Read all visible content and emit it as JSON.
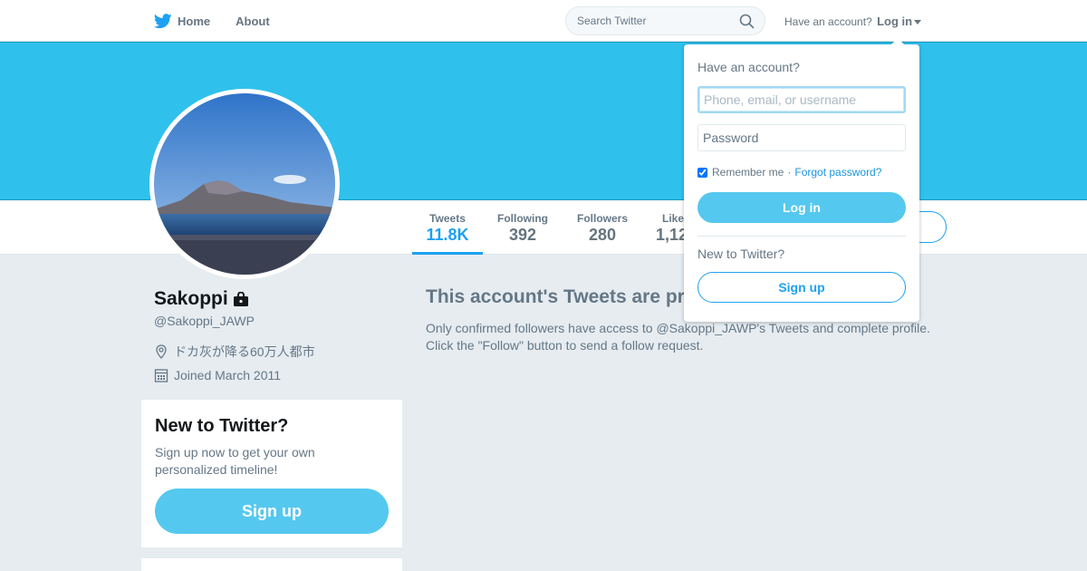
{
  "topbar": {
    "home_label": "Home",
    "about_label": "About",
    "search_placeholder": "Search Twitter",
    "have_account_text": "Have an account?",
    "login_label": "Log in"
  },
  "profile": {
    "name": "Sakoppi",
    "handle": "@Sakoppi_JAWP",
    "location": "ドカ灰が降る60万人都市",
    "joined": "Joined March 2011"
  },
  "stats": [
    {
      "label": "Tweets",
      "value": "11.8K",
      "active": true
    },
    {
      "label": "Following",
      "value": "392",
      "active": false
    },
    {
      "label": "Followers",
      "value": "280",
      "active": false
    },
    {
      "label": "Likes",
      "value": "1,12",
      "active": false
    }
  ],
  "signup_card": {
    "title": "New to Twitter?",
    "text": "Sign up now to get your own personalized timeline!",
    "button": "Sign up"
  },
  "protected": {
    "title": "This account's Tweets are protected.",
    "line1": "Only confirmed followers have access to @Sakoppi_JAWP's Tweets and complete profile.",
    "line2": "Click the \"Follow\" button to send a follow request."
  },
  "login_dropdown": {
    "heading": "Have an account?",
    "username_placeholder": "Phone, email, or username",
    "password_placeholder": "Password",
    "remember_label": "Remember me",
    "separator": "·",
    "forgot_label": "Forgot password?",
    "login_button": "Log in",
    "new_heading": "New to Twitter?",
    "signup_button": "Sign up"
  },
  "colors": {
    "banner": "#2fc1ec",
    "accent": "#1da1f2",
    "button_fill": "#55c8ef",
    "page_bg": "#e6ecf0"
  }
}
